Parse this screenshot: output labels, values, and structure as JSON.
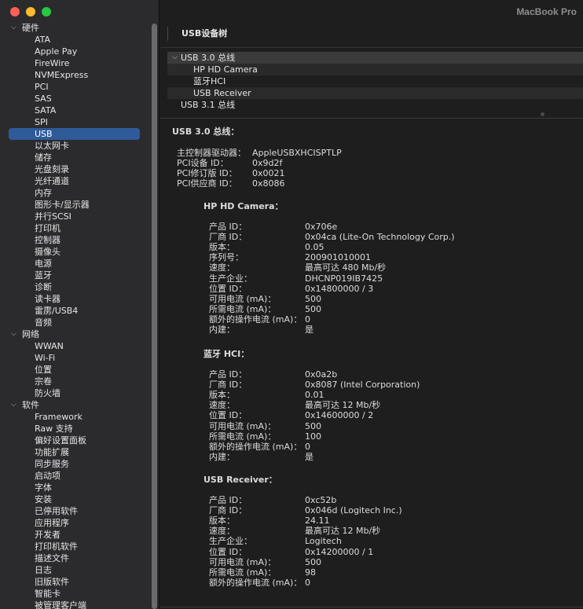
{
  "window": {
    "machine_name": "MacBook Pro"
  },
  "sidebar": {
    "groups": [
      {
        "label": "硬件",
        "items": [
          "ATA",
          "Apple Pay",
          "FireWire",
          "NVMExpress",
          "PCI",
          "SAS",
          "SATA",
          "SPI",
          "USB",
          "以太网卡",
          "储存",
          "光盘刻录",
          "光纤通道",
          "内存",
          "图形卡/显示器",
          "并行SCSI",
          "打印机",
          "控制器",
          "摄像头",
          "电源",
          "蓝牙",
          "诊断",
          "读卡器",
          "雷雳/USB4",
          "音频"
        ]
      },
      {
        "label": "网络",
        "items": [
          "WWAN",
          "Wi-Fi",
          "位置",
          "宗卷",
          "防火墙"
        ]
      },
      {
        "label": "软件",
        "items": [
          "Framework",
          "Raw 支持",
          "偏好设置面板",
          "功能扩展",
          "同步服务",
          "启动项",
          "字体",
          "安装",
          "已停用软件",
          "应用程序",
          "开发者",
          "打印机软件",
          "描述文件",
          "日志",
          "旧版软件",
          "智能卡",
          "被管理客户端"
        ]
      }
    ],
    "selected_item": "USB"
  },
  "main": {
    "section_title": "USB设备树",
    "tree": [
      {
        "label": "USB 3.0 总线",
        "level": 0,
        "expanded": true
      },
      {
        "label": "HP HD Camera",
        "level": 1
      },
      {
        "label": "蓝牙HCI",
        "level": 1
      },
      {
        "label": "USB Receiver",
        "level": 1
      },
      {
        "label": "USB 3.1 总线",
        "level": 0
      }
    ],
    "detail": {
      "bus_title": "USB 3.0 总线：",
      "bus_fields": [
        {
          "label": "主控制器驱动器：",
          "value": "AppleUSBXHCISPTLP"
        },
        {
          "label": "PCI设备 ID：",
          "value": "0x9d2f"
        },
        {
          "label": "PCI修订版 ID：",
          "value": "0x0021"
        },
        {
          "label": "PCI供应商 ID：",
          "value": "0x8086"
        }
      ],
      "devices": [
        {
          "title": "HP HD Camera：",
          "fields": [
            {
              "label": "产品 ID：",
              "value": "0x706e"
            },
            {
              "label": "厂商 ID：",
              "value": "0x04ca  (Lite-On Technology Corp.)"
            },
            {
              "label": "版本：",
              "value": "0.05"
            },
            {
              "label": "序列号：",
              "value": "200901010001"
            },
            {
              "label": "速度：",
              "value": "最高可达 480 Mb/秒"
            },
            {
              "label": "生产企业：",
              "value": "DHCNP019IB7425"
            },
            {
              "label": "位置 ID：",
              "value": "0x14800000 / 3"
            },
            {
              "label": "可用电流 (mA)：",
              "value": "500"
            },
            {
              "label": "所需电流 (mA)：",
              "value": "500"
            },
            {
              "label": "额外的操作电流 (mA)：",
              "value": "0"
            },
            {
              "label": "内建：",
              "value": "是"
            }
          ]
        },
        {
          "title": "蓝牙 HCI：",
          "fields": [
            {
              "label": "产品 ID：",
              "value": "0x0a2b"
            },
            {
              "label": "厂商 ID：",
              "value": "0x8087  (Intel Corporation)"
            },
            {
              "label": "版本：",
              "value": "0.01"
            },
            {
              "label": "速度：",
              "value": "最高可达 12 Mb/秒"
            },
            {
              "label": "位置 ID：",
              "value": "0x14600000 / 2"
            },
            {
              "label": "可用电流 (mA)：",
              "value": "500"
            },
            {
              "label": "所需电流 (mA)：",
              "value": "100"
            },
            {
              "label": "额外的操作电流 (mA)：",
              "value": "0"
            },
            {
              "label": "内建：",
              "value": "是"
            }
          ]
        },
        {
          "title": "USB Receiver：",
          "fields": [
            {
              "label": "产品 ID：",
              "value": "0xc52b"
            },
            {
              "label": "厂商 ID：",
              "value": "0x046d  (Logitech Inc.)"
            },
            {
              "label": "版本：",
              "value": "24.11"
            },
            {
              "label": "速度：",
              "value": "最高可达 12 Mb/秒"
            },
            {
              "label": "生产企业：",
              "value": "Logitech"
            },
            {
              "label": "位置 ID：",
              "value": "0x14200000 / 1"
            },
            {
              "label": "可用电流 (mA)：",
              "value": "500"
            },
            {
              "label": "所需电流 (mA)：",
              "value": "98"
            },
            {
              "label": "额外的操作电流 (mA)：",
              "value": "0"
            }
          ]
        }
      ]
    }
  }
}
